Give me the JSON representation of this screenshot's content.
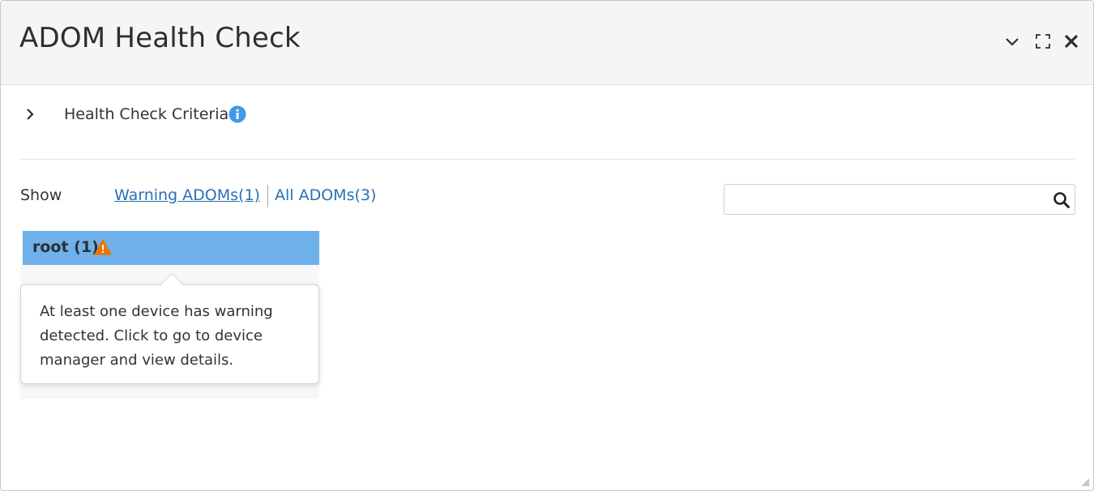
{
  "dialog": {
    "title": "ADOM Health Check"
  },
  "header_controls": {
    "collapse_icon": "chevron-down-icon",
    "maximize_icon": "maximize-icon",
    "close_icon": "close-icon"
  },
  "criteria": {
    "label": "Health Check Criteria",
    "expand_icon": "chevron-right-icon",
    "info_icon": "info-icon"
  },
  "filters": {
    "show_label": "Show",
    "warning_adoms": "Warning ADOMs(1)",
    "all_adoms": "All ADOMs(3)"
  },
  "search": {
    "value": "",
    "placeholder": "",
    "icon": "search-icon"
  },
  "adoms": [
    {
      "name": "root (1)",
      "status_icon": "warning-icon"
    }
  ],
  "tooltip": {
    "text": "At least one device has warning detected. Click to go to device manager and view details."
  },
  "colors": {
    "link": "#2a6fb5",
    "tile": "#6fb1ea",
    "warning": "#e8760a",
    "info": "#3d9be9",
    "header_bg": "#f5f5f5"
  }
}
